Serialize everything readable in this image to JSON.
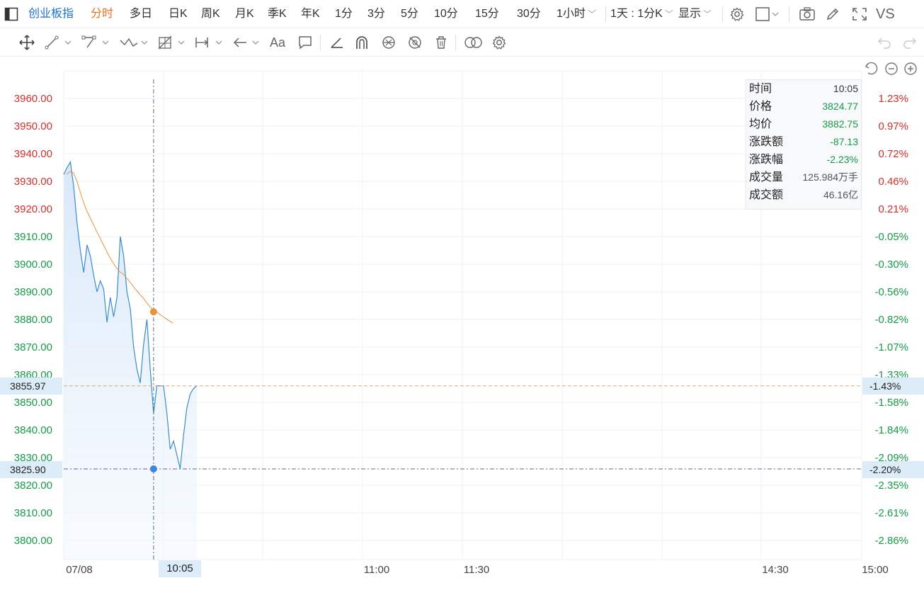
{
  "toolbar": {
    "index_name": "创业板指",
    "tabs": [
      "分时",
      "多日",
      "日K",
      "周K",
      "月K",
      "季K",
      "年K",
      "1分",
      "3分",
      "5分",
      "10分",
      "15分",
      "30分"
    ],
    "active_tab": "分时",
    "dropdown_hour": "1小时",
    "dropdown_day": "1天 : 1分K",
    "dropdown_display": "显示",
    "vs_label": "VS"
  },
  "drawing_tools": {
    "text_tool_label": "Aa"
  },
  "chart_data": {
    "type": "line",
    "x_axis_ticks": [
      "07/08",
      "11:00",
      "11:30",
      "14:30",
      "15:00"
    ],
    "crosshair_time": "10:05",
    "y_left_ticks": [
      "3960.00",
      "3950.00",
      "3940.00",
      "3930.00",
      "3920.00",
      "3910.00",
      "3900.00",
      "3890.00",
      "3880.00",
      "3870.00",
      "3860.00",
      "3850.00",
      "3840.00",
      "3830.00",
      "3820.00",
      "3810.00",
      "3800.00"
    ],
    "y_right_ticks": [
      "1.23%",
      "0.97%",
      "0.72%",
      "0.46%",
      "0.21%",
      "-0.05%",
      "-0.30%",
      "-0.56%",
      "-0.82%",
      "-1.07%",
      "-1.33%",
      "-1.58%",
      "-1.84%",
      "-2.09%",
      "-2.35%",
      "-2.61%",
      "-2.86%"
    ],
    "ylim": [
      3800,
      3960
    ],
    "ref_line_label": "3855.97",
    "ref_line_pct": "-1.43%",
    "crosshair_price": "3825.90",
    "crosshair_pct": "-2.20%",
    "series": [
      {
        "values": [
          3932.5,
          3935,
          3937,
          3928,
          3915,
          3905,
          3897,
          3907,
          3903,
          3896,
          3890,
          3894,
          3891,
          3879,
          3888,
          3881,
          3888,
          3910,
          3903,
          3890,
          3884,
          3870,
          3862,
          3857,
          3871,
          3880,
          3862,
          3846,
          3856,
          3856,
          3856,
          3846,
          3833,
          3836,
          3831,
          3826,
          3838,
          3848,
          3853,
          3855,
          3856
        ]
      },
      {
        "values": [
          3932.5,
          3933.5,
          3933.2,
          3930.5,
          3926.5,
          3922.8,
          3919.5,
          3917,
          3914.5,
          3912,
          3909.7,
          3907.2,
          3904.8,
          3902.5,
          3900.5,
          3898.7,
          3897.2,
          3896.5,
          3895.1,
          3893.6,
          3892,
          3890.6,
          3889.1,
          3887.8,
          3886.2,
          3884.7,
          3883.5,
          3882.75,
          3881.9,
          3881,
          3880.2,
          3879.4,
          3878.7
        ]
      }
    ],
    "grid": true,
    "colors": {
      "price": "#3b8ccc",
      "avg": "#e8923a",
      "up": "#d0302c",
      "down": "#169a48",
      "fill": "#e3effb"
    }
  },
  "info_panel": {
    "rows": [
      {
        "label": "时间",
        "value": "10:05",
        "color": "#333333"
      },
      {
        "label": "价格",
        "value": "3824.77",
        "color": "#169a48"
      },
      {
        "label": "均价",
        "value": "3882.75",
        "color": "#169a48"
      },
      {
        "label": "涨跌额",
        "value": "-87.13",
        "color": "#169a48"
      },
      {
        "label": "涨跌幅",
        "value": "-2.23%",
        "color": "#169a48"
      },
      {
        "label": "成交量",
        "value": "125.984万手",
        "color": "#555555"
      },
      {
        "label": "成交额",
        "value": "46.16亿",
        "color": "#555555"
      }
    ]
  }
}
